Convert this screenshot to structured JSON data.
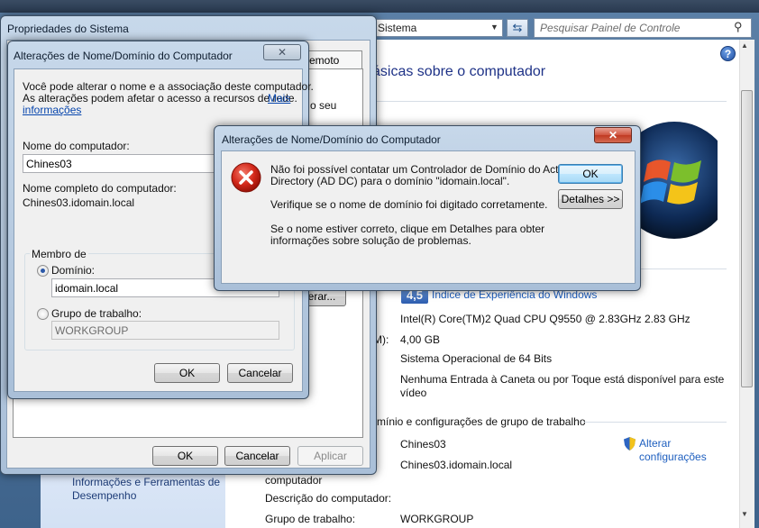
{
  "control_panel": {
    "address_text": "Sistema",
    "search_placeholder": "Pesquisar Painel de Controle",
    "heading": "ásicas sobre o computador",
    "rating_badge": "4,5",
    "rating_link": "Índice de Experiência do Windows",
    "processor_value": "Intel(R) Core(TM)2 Quad  CPU   Q9550  @ 2.83GHz   2.83 GHz",
    "memory_label_fragment": "M):",
    "memory_value": "4,00 GB",
    "system_type_value": "Sistema Operacional de 64 Bits",
    "pen_touch_value_line1": "Nenhuma Entrada à Caneta ou por Toque está disponível para este",
    "pen_touch_value_line2": "vídeo",
    "section_heading": "mínio e configurações de grupo de trabalho",
    "computer_name_value": "Chines03",
    "full_name_value": "Chines03.idomain.local",
    "full_name_label_fragment": "computador",
    "description_label": "Descrição do computador:",
    "workgroup_label": "Grupo de trabalho:",
    "workgroup_value": "WORKGROUP",
    "change_settings_line1": "Alterar",
    "change_settings_line2": "configurações",
    "sidebar_link_line1": "Informações e Ferramentas de",
    "sidebar_link_line2": "Desempenho"
  },
  "system_properties": {
    "title": "Propriedades do Sistema",
    "tab_remote_fragment": "emoto",
    "body_fragment": "o seu",
    "change_button_fragment": "erar...",
    "ok_label": "OK",
    "cancel_label": "Cancelar",
    "apply_label": "Aplicar"
  },
  "name_change": {
    "title": "Alterações de Nome/Domínio do Computador",
    "intro_line1": "Você pode alterar o nome e a associação deste computador.",
    "intro_line2": "As alterações podem afetar o acesso a recursos de rede.",
    "more_info_link_part1": "Mais",
    "more_info_link_part2": "informações",
    "computer_name_label": "Nome do computador:",
    "computer_name_value": "Chines03",
    "full_name_label": "Nome completo do computador:",
    "full_name_value": "Chines03.idomain.local",
    "member_of_label": "Membro de",
    "domain_label": "Domínio:",
    "domain_value": "idomain.local",
    "workgroup_label": "Grupo de trabalho:",
    "workgroup_value": "WORKGROUP",
    "domain_selected": true,
    "ok_label": "OK",
    "cancel_label": "Cancelar"
  },
  "error_dialog": {
    "title": "Alterações de Nome/Domínio do Computador",
    "message_line1": "Não foi possível contatar um Controlador de Domínio do Active",
    "message_line2": "Directory (AD DC) para o domínio \"idomain.local\".",
    "message_line3": "Verifique se o nome de domínio foi digitado corretamente.",
    "message_line4": "Se o nome estiver correto, clique em Detalhes para obter",
    "message_line5": "informações sobre solução de problemas.",
    "ok_label": "OK",
    "details_label": "Detalhes >>",
    "close_symbol": "✕"
  },
  "icons": {
    "close": "close-icon",
    "error": "error-icon",
    "search": "search-icon",
    "help": "help-icon",
    "shield": "shield-icon"
  }
}
